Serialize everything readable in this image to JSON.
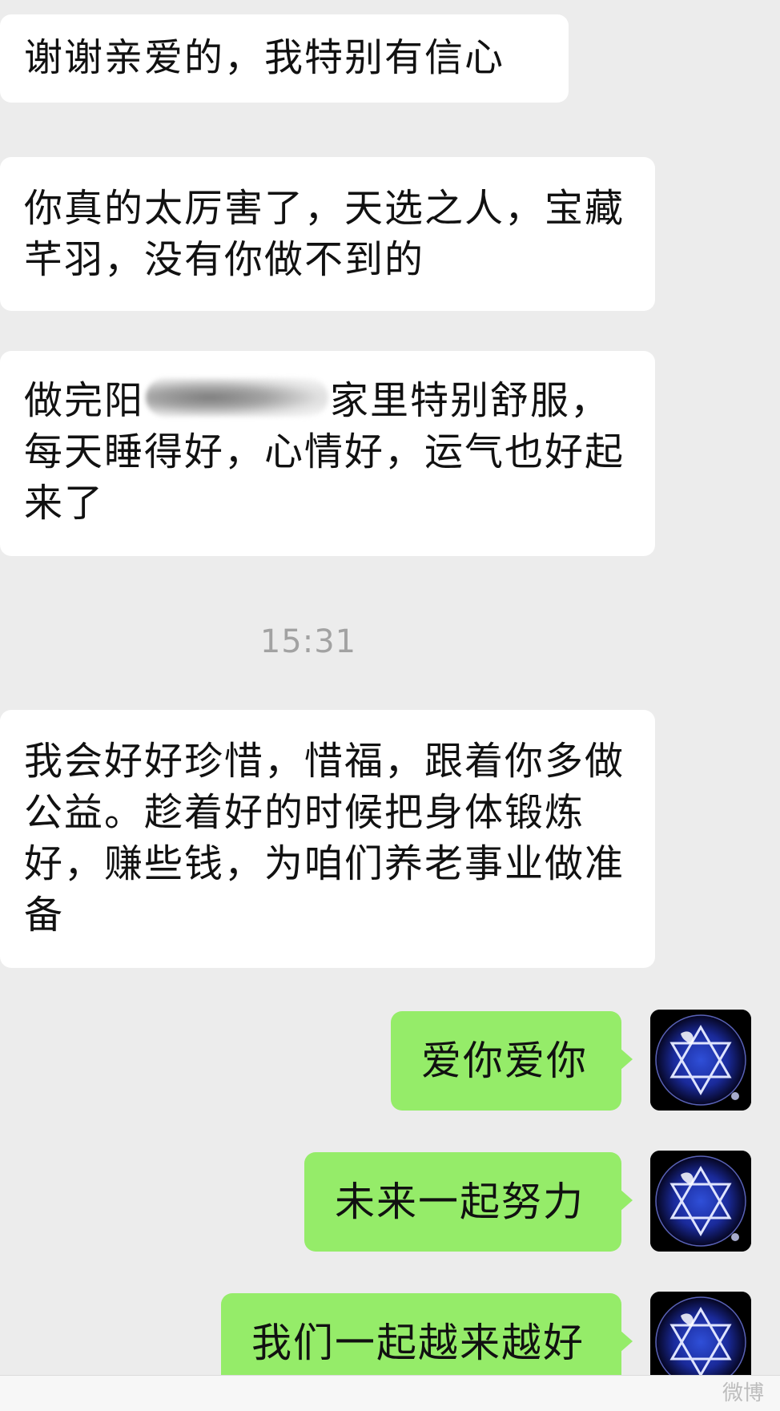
{
  "messages": {
    "m1": "谢谢亲爱的，我特别有信心",
    "m2": "你真的太厉害了，天选之人，宝藏芊羽，没有你做不到的",
    "m3_before": "做完阳",
    "m3_after": "家里特别舒服，每天睡得好，心情好，运气也好起来了",
    "timestamp": "15:31",
    "m4": "我会好好珍惜，惜福，跟着你多做公益。趁着好的时候把身体锻炼好，赚些钱，为咱们养老事业做准备",
    "m5": "爱你爱你",
    "m6": "未来一起努力",
    "m7": "我们一起越来越好"
  },
  "watermark": "微博",
  "colors": {
    "background": "#ececec",
    "incoming_bubble": "#ffffff",
    "outgoing_bubble": "#95ec69",
    "timestamp": "#a2a2a2"
  },
  "icons": {
    "avatar": "hexagram-star-avatar"
  }
}
